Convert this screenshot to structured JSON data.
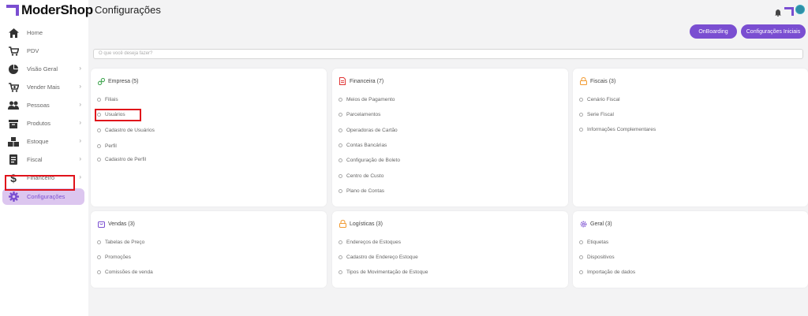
{
  "brand": {
    "name": "ModerShop"
  },
  "header": {
    "title": "Configurações"
  },
  "actions": {
    "onboarding": "OnBoarding",
    "initial_settings": "Configurações Iniciais"
  },
  "search": {
    "placeholder": "O que você deseja fazer?"
  },
  "sidebar": {
    "items": [
      {
        "label": "Home",
        "icon": "home-icon"
      },
      {
        "label": "PDV",
        "icon": "cart-icon"
      },
      {
        "label": "Visão Geral",
        "icon": "pie-chart-icon"
      },
      {
        "label": "Vender Mais",
        "icon": "cart-plus-icon"
      },
      {
        "label": "Pessoas",
        "icon": "people-icon"
      },
      {
        "label": "Produtos",
        "icon": "box-icon"
      },
      {
        "label": "Estoque",
        "icon": "boxes-icon"
      },
      {
        "label": "Fiscal",
        "icon": "receipt-icon"
      },
      {
        "label": "Financeiro",
        "icon": "dollar-icon"
      },
      {
        "label": "Configurações",
        "icon": "gear-icon"
      }
    ]
  },
  "cards": [
    {
      "title": "Empresa (5)",
      "icon": "link-icon",
      "items": [
        "Filiais",
        "Usuários",
        "Cadastro de Usuários",
        "Perfil",
        "Cadastro de Perfil"
      ]
    },
    {
      "title": "Financeira (7)",
      "icon": "document-icon",
      "items": [
        "Meios de Pagamento",
        "Parcelamentos",
        "Operadoras de Cartão",
        "Contas Bancárias",
        "Configuração de Boleto",
        "Centro de Custo",
        "Plano de Contas"
      ]
    },
    {
      "title": "Fiscais (3)",
      "icon": "lock-icon",
      "items": [
        "Cenário Fiscal",
        "Serie Fiscal",
        "Informações Complementares"
      ]
    },
    {
      "title": "Vendas (3)",
      "icon": "bag-icon",
      "items": [
        "Tabelas de Preço",
        "Promoções",
        "Comissões de venda"
      ]
    },
    {
      "title": "Logísticas (3)",
      "icon": "lock-icon",
      "items": [
        "Endereços de Estoques",
        "Cadastro de Endereço Estoque",
        "Tipos de Movimentação de Estoque"
      ]
    },
    {
      "title": "Geral (3)",
      "icon": "gear-icon",
      "items": [
        "Etiquetas",
        "Dispositivos",
        "Importação de dados"
      ]
    }
  ],
  "colors": {
    "accent": "#7a4ed1",
    "active_bg": "#dcc6ef",
    "highlight": "#e0131b"
  }
}
